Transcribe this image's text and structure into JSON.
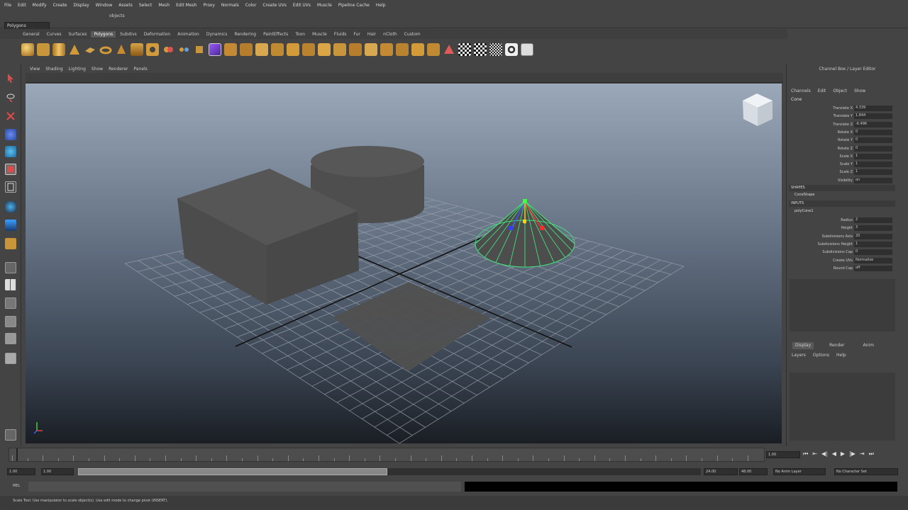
{
  "menu": {
    "items": [
      "File",
      "Edit",
      "Modify",
      "Create",
      "Display",
      "Window",
      "Assets",
      "Select",
      "Mesh",
      "Edit Mesh",
      "Proxy",
      "Normals",
      "Color",
      "Create UVs",
      "Edit UVs",
      "Muscle",
      "Pipeline Cache",
      "Help"
    ]
  },
  "status": {
    "mode": "Polygons",
    "objects_label": "objects"
  },
  "shelf": {
    "tabs": [
      "General",
      "Curves",
      "Surfaces",
      "Polygons",
      "Subdivs",
      "Deformation",
      "Animation",
      "Dynamics",
      "Rendering",
      "PaintEffects",
      "Toon",
      "Muscle",
      "Fluids",
      "Fur",
      "Hair",
      "nCloth",
      "Custom"
    ],
    "active_tab": "Polygons"
  },
  "panel": {
    "menus": [
      "View",
      "Shading",
      "Lighting",
      "Show",
      "Renderer",
      "Panels"
    ]
  },
  "channel_box": {
    "title": "Channel Box / Layer Editor",
    "menus": [
      "Channels",
      "Edit",
      "Object",
      "Show"
    ],
    "object_name": "Cone",
    "channels": [
      {
        "label": "Translate X",
        "value": "4.339"
      },
      {
        "label": "Translate Y",
        "value": "1.844"
      },
      {
        "label": "Translate Z",
        "value": "-6.496"
      },
      {
        "label": "Rotate X",
        "value": "0"
      },
      {
        "label": "Rotate Y",
        "value": "0"
      },
      {
        "label": "Rotate Z",
        "value": "0"
      },
      {
        "label": "Scale X",
        "value": "1"
      },
      {
        "label": "Scale Y",
        "value": "1"
      },
      {
        "label": "Scale Z",
        "value": "1"
      },
      {
        "label": "Visibility",
        "value": "on"
      }
    ],
    "shapes_header": "SHAPES",
    "shape_name": "ConeShape",
    "inputs_header": "INPUTS",
    "input_name": "polyCone1",
    "inputs": [
      {
        "label": "Radius",
        "value": "2"
      },
      {
        "label": "Height",
        "value": "3"
      },
      {
        "label": "Subdivisions Axis",
        "value": "20"
      },
      {
        "label": "Subdivisions Height",
        "value": "1"
      },
      {
        "label": "Subdivisions Cap",
        "value": "0"
      },
      {
        "label": "Create UVs",
        "value": "Normalize"
      },
      {
        "label": "Round Cap",
        "value": "off"
      }
    ]
  },
  "layer_editor": {
    "tabs": [
      "Display",
      "Render",
      "Anim"
    ],
    "menus": [
      "Layers",
      "Options",
      "Help"
    ],
    "active_tab": "Display"
  },
  "timeline": {
    "start": "1.00",
    "current": "1.00",
    "range_start": "1.00",
    "range_end": "24.00",
    "anim_end": "48.00",
    "playback_start": "1.00",
    "anim_layer": "No Anim Layer",
    "char_set": "No Character Set"
  },
  "command": {
    "lang": "MEL"
  },
  "help": {
    "text": "Scale Tool: Use manipulator to scale object(s). Use edit mode to change pivot (INSERT)."
  },
  "colors": {
    "ui_bg": "#444444",
    "selection": "#43e07a",
    "viewport_top": "#9aa8b9",
    "viewport_bottom": "#1a1e24"
  }
}
